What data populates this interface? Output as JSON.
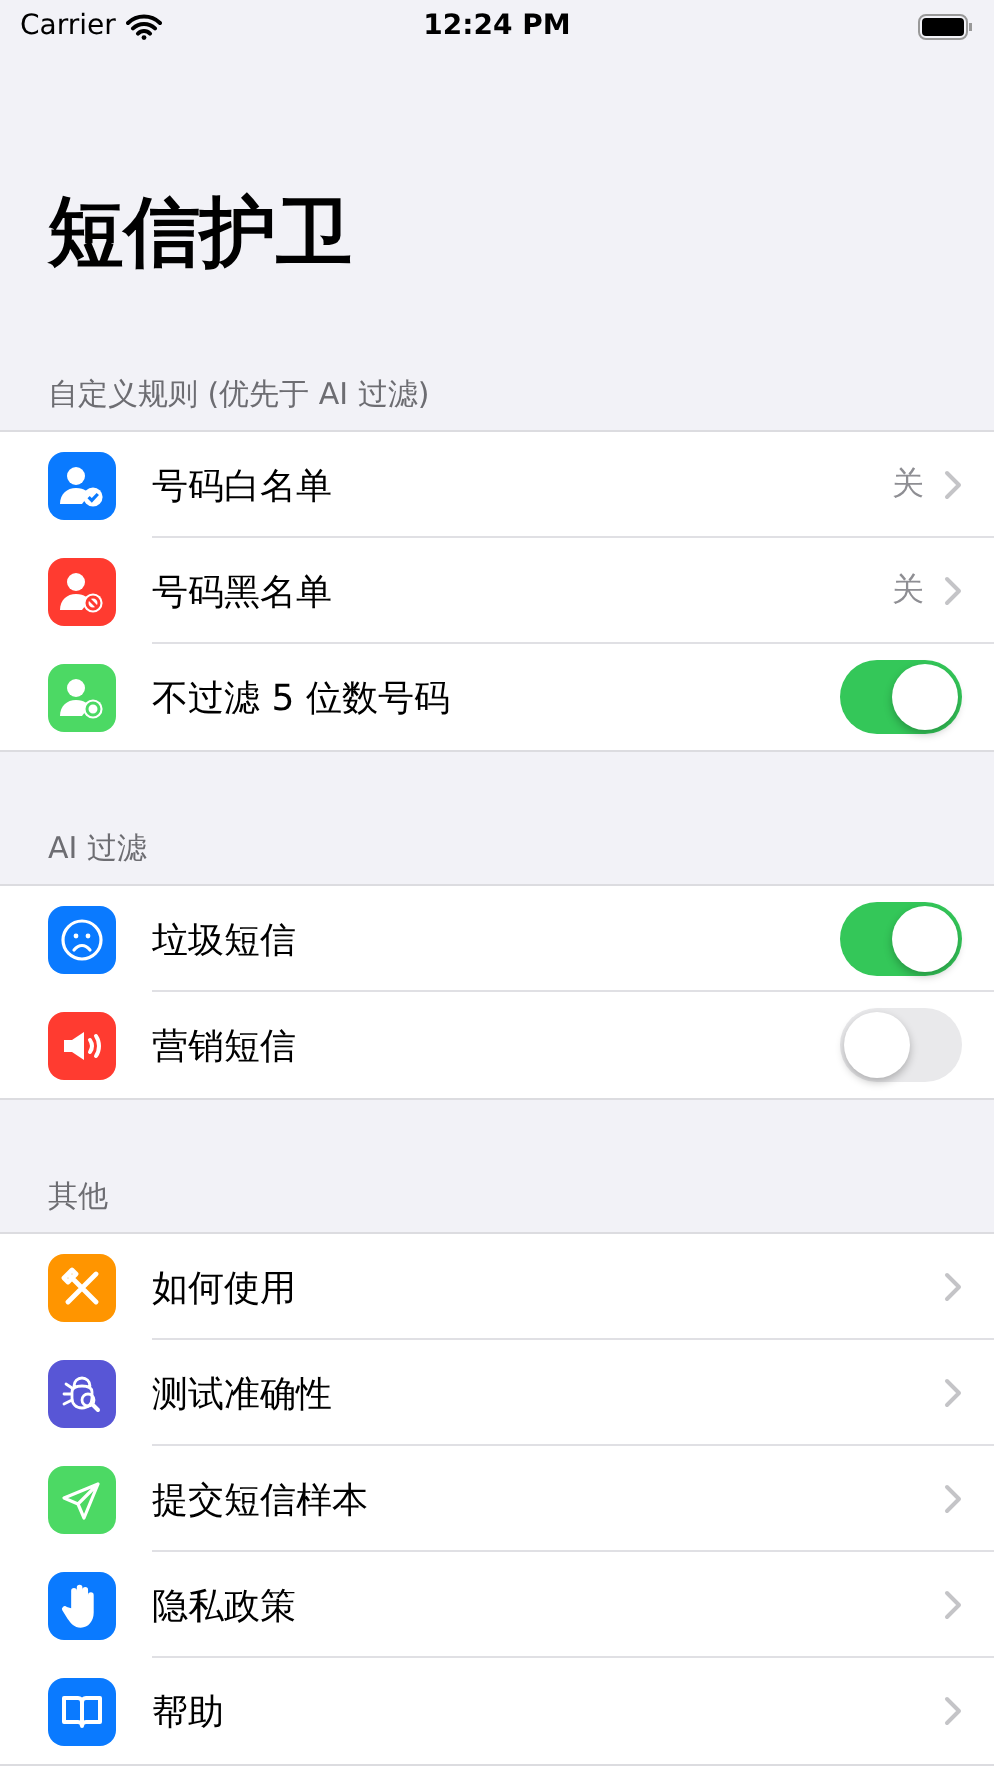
{
  "status_bar": {
    "carrier": "Carrier",
    "time": "12:24 PM"
  },
  "title": "短信护卫",
  "sections": [
    {
      "header": "自定义规则 (优先于 AI 过滤)",
      "rows": [
        {
          "kind": "nav",
          "label": "号码白名单",
          "value": "关",
          "color": "#0a7aff"
        },
        {
          "kind": "nav",
          "label": "号码黑名单",
          "value": "关",
          "color": "#ff3b30"
        },
        {
          "kind": "switch",
          "label": "不过滤 5 位数号码",
          "on": true,
          "color": "#4cd964"
        }
      ]
    },
    {
      "header": "AI 过滤",
      "rows": [
        {
          "kind": "switch",
          "label": "垃圾短信",
          "on": true,
          "color": "#0a7aff"
        },
        {
          "kind": "switch",
          "label": "营销短信",
          "on": false,
          "color": "#ff3b30"
        }
      ]
    },
    {
      "header": "其他",
      "rows": [
        {
          "kind": "nav",
          "label": "如何使用",
          "color": "#ff9500"
        },
        {
          "kind": "nav",
          "label": "测试准确性",
          "color": "#5856d6"
        },
        {
          "kind": "nav",
          "label": "提交短信样本",
          "color": "#4cd964"
        },
        {
          "kind": "nav",
          "label": "隐私政策",
          "color": "#0a7aff"
        },
        {
          "kind": "nav",
          "label": "帮助",
          "color": "#0a7aff"
        }
      ]
    }
  ]
}
